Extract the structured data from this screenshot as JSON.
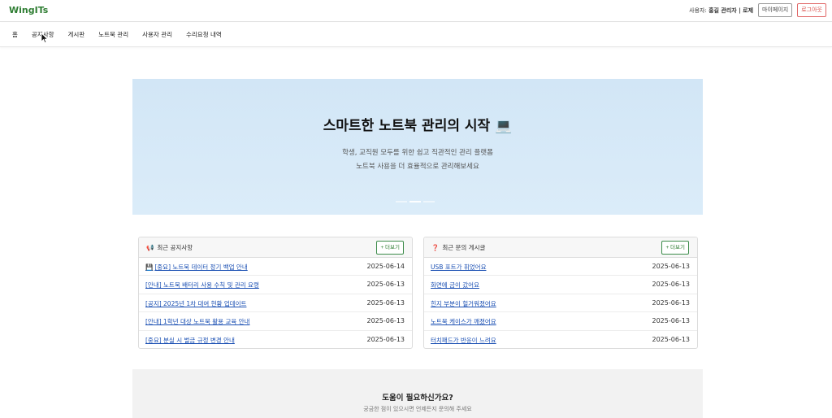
{
  "header": {
    "logo": "WingITs",
    "user_prefix": "사용자:",
    "user_name": "홍길 관리자 | 로제",
    "mypage_label": "마이페이지",
    "logout_label": "로그아웃"
  },
  "nav": {
    "items": [
      "홈",
      "공지사항",
      "게시판",
      "노트북 관리",
      "사용자 관리",
      "수리요청 내역"
    ]
  },
  "hero": {
    "title": "스마트한 노트북 관리의 시작 💻",
    "subtitle_line1": "학생, 교직원 모두를 위한 쉽고 직관적인 관리 플랫폼",
    "subtitle_line2": "노트북 사용을 더 효율적으로 관리해보세요"
  },
  "notices": {
    "icon": "📢",
    "title": "최근 공지사항",
    "more_label": "+ 더보기",
    "rows": [
      {
        "icon": "💾",
        "title": "[중요] 노트북 데이터 정기 백업 안내",
        "date": "2025-06-14"
      },
      {
        "icon": "",
        "title": "[안내] 노트북 배터리 사용 수칙 및 관리 요령",
        "date": "2025-06-13"
      },
      {
        "icon": "",
        "title": "[공지] 2025년 1차 대여 현황 업데이트",
        "date": "2025-06-13"
      },
      {
        "icon": "",
        "title": "[안내] 1학년 대상 노트북 활용 교육 안내",
        "date": "2025-06-13"
      },
      {
        "icon": "",
        "title": "[중요] 분실 시 벌금 규정 변경 안내",
        "date": "2025-06-13"
      }
    ]
  },
  "questions": {
    "icon": "❓",
    "title": "최근 문의 게시글",
    "more_label": "+ 더보기",
    "rows": [
      {
        "title": "USB 포트가 휘었어요",
        "date": "2025-06-13"
      },
      {
        "title": "화면에 금이 갔어요",
        "date": "2025-06-13"
      },
      {
        "title": "힌지 부분이 헐거워졌어요",
        "date": "2025-06-13"
      },
      {
        "title": "노트북 케이스가 깨졌어요",
        "date": "2025-06-13"
      },
      {
        "title": "터치패드가 반응이 느려요",
        "date": "2025-06-13"
      }
    ]
  },
  "help": {
    "title": "도움이 필요하신가요?",
    "subtitle": "궁금한 점이 있으시면 언제든지 문의해 주세요"
  },
  "colors": {
    "logo": "#2e7d32",
    "hero_bg": "#d6e9f8",
    "link": "#1a4fb3",
    "logout": "#d9534f"
  }
}
